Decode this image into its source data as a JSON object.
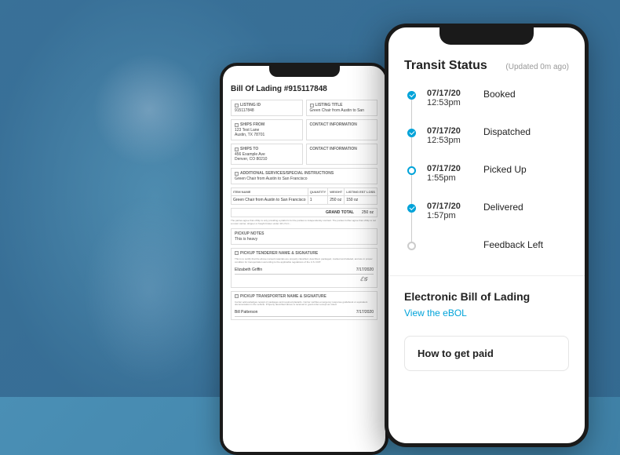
{
  "bol": {
    "title": "Bill Of Lading #915117848",
    "listing_id_label": "LISTING ID",
    "listing_id": "915117848",
    "listing_title_label": "LISTING TITLE",
    "listing_title": "Green Chair from Austin to San",
    "ships_from_label": "SHIPS FROM",
    "ships_from": "123 Test Lane\nAustin, TX 78701",
    "ships_to_label": "SHIPS TO",
    "ships_to": "456 Example Ave\nDenver, CO 80210",
    "contact_label": "CONTACT INFORMATION",
    "addl_services_label": "ADDITIONAL SERVICES/SPECIAL INSTRUCTIONS",
    "addl_services": "Green Chair from Austin to San Francisco",
    "table": {
      "headers": [
        "ITEM NAME",
        "QUANTITY",
        "WEIGHT",
        "LISTING EST LOSS"
      ],
      "rows": [
        [
          "Green Chair from Austin to San Francisco",
          "1",
          "250 oz",
          "150 oz"
        ]
      ]
    },
    "grand_total_label": "GRAND TOTAL",
    "grand_total": "250 oz",
    "legal_text": "The parties agree that uShip is only providing a platform for the parties to independently contract. The parties further agree that uShip is not a motor carrier, shipper or freight broker under 49 U.S.C...",
    "pickup_notes_label": "PICKUP NOTES",
    "pickup_notes": "This is heavy",
    "tenderer_label": "PICKUP TENDERER NAME & SIGNATURE",
    "tenderer_text": "This is to certify that the above named materials are properly classified, described, packaged, marked and labeled, and are in proper condition for transportation according to the applicable regulations of the U.S. DOT.",
    "tenderer_name": "Elizabeth Griffin",
    "tenderer_date": "7/17/2020",
    "transporter_label": "PICKUP TRANSPORTER NAME & SIGNATURE",
    "transporter_text": "Carrier acknowledges receipt of packages and required placards. Carrier certifies emergency response guidebook or equivalent documentation in the vehicle. Property described above is received in good order except as noted.",
    "transporter_name": "Bill Patterson",
    "transporter_date": "7/17/2020"
  },
  "transit": {
    "title": "Transit Status",
    "updated": "(Updated 0m ago)",
    "steps": [
      {
        "date": "07/17/20",
        "time": "12:53pm",
        "label": "Booked",
        "state": "done"
      },
      {
        "date": "07/17/20",
        "time": "12:53pm",
        "label": "Dispatched",
        "state": "done"
      },
      {
        "date": "07/17/20",
        "time": "1:55pm",
        "label": "Picked Up",
        "state": "current"
      },
      {
        "date": "07/17/20",
        "time": "1:57pm",
        "label": "Delivered",
        "state": "done"
      },
      {
        "date": "",
        "time": "",
        "label": "Feedback Left",
        "state": "pending"
      }
    ],
    "ebol_title": "Electronic Bill of Lading",
    "ebol_link": "View the eBOL",
    "paid_title": "How to get paid"
  }
}
